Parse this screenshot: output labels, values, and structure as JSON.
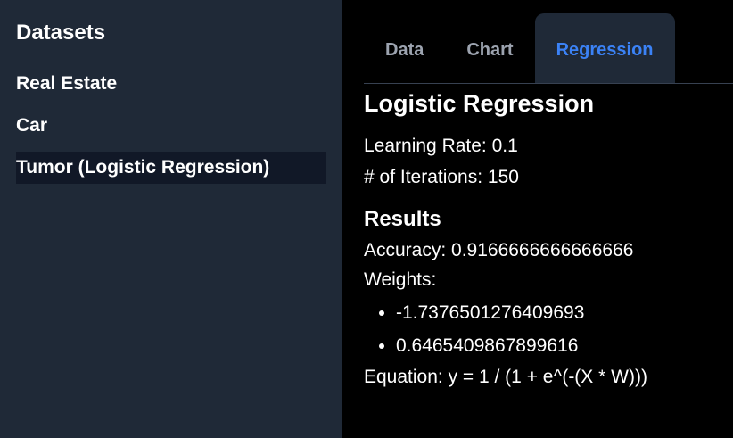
{
  "sidebar": {
    "title": "Datasets",
    "items": [
      {
        "label": "Real Estate",
        "active": false
      },
      {
        "label": "Car",
        "active": false
      },
      {
        "label": "Tumor (Logistic Regression)",
        "active": true
      }
    ]
  },
  "tabs": [
    {
      "label": "Data",
      "active": false
    },
    {
      "label": "Chart",
      "active": false
    },
    {
      "label": "Regression",
      "active": true
    }
  ],
  "content": {
    "heading": "Logistic Regression",
    "learning_rate": "Learning Rate: 0.1",
    "iterations": "# of Iterations: 150",
    "results_heading": "Results",
    "accuracy": "Accuracy: 0.9166666666666666",
    "weights_label": "Weights:",
    "weights": [
      "-1.7376501276409693",
      "0.6465409867899616"
    ],
    "equation": "Equation: y = 1 / (1 + e^(-(X * W)))"
  },
  "colors": {
    "sidebar_bg": "#1f2937",
    "active_item_bg": "#111827",
    "tab_active_text": "#3b82f6",
    "tab_inactive_text": "#9ca3af",
    "main_bg": "#000000"
  }
}
